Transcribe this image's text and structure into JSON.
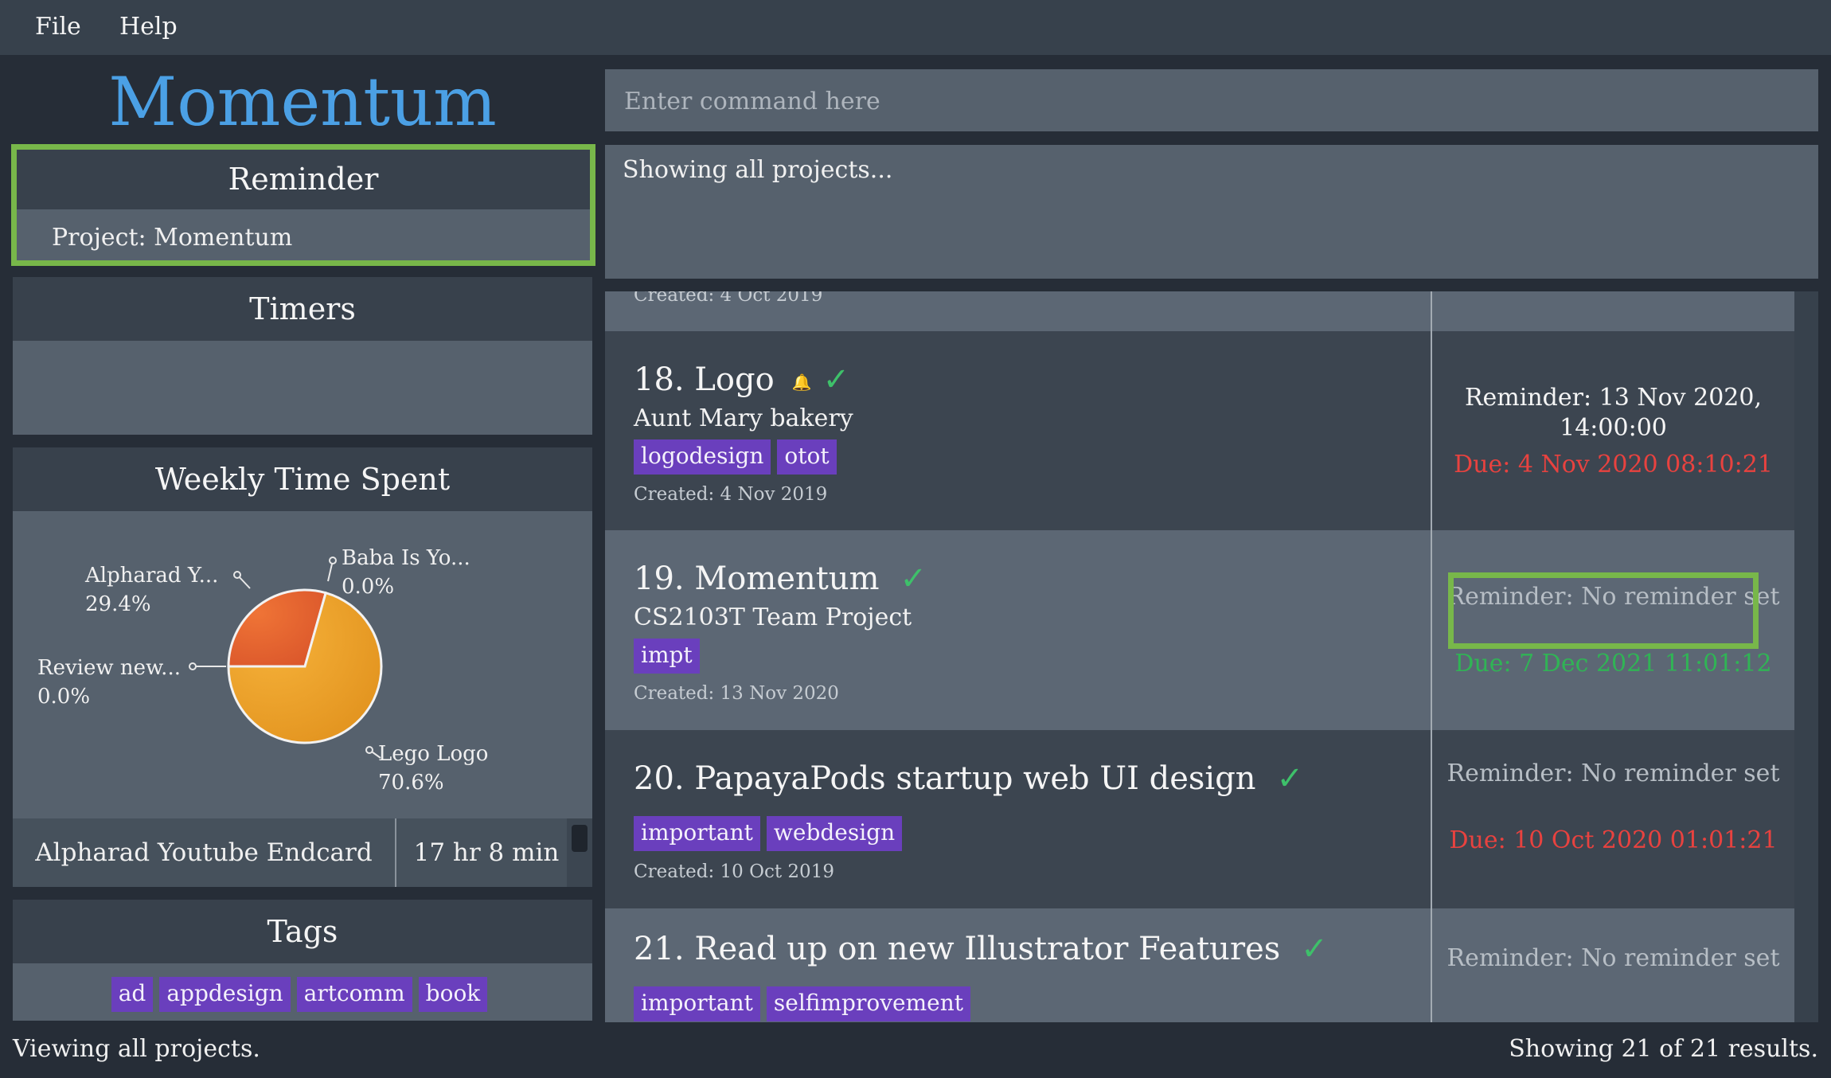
{
  "menu": {
    "file": "File",
    "help": "Help"
  },
  "app_title": "Momentum",
  "reminder": {
    "title": "Reminder",
    "text": "Project: Momentum"
  },
  "timers": {
    "title": "Timers"
  },
  "weekly": {
    "title": "Weekly Time Spent",
    "slices": [
      {
        "label": "Alpharad Y...",
        "value_text": "29.4%",
        "value": 29.4,
        "color": "#e5672f"
      },
      {
        "label": "Baba Is Yo...",
        "value_text": "0.0%",
        "value": 0.0,
        "color": "#f2c94c"
      },
      {
        "label": "Review new...",
        "value_text": "0.0%",
        "value": 0.0,
        "color": "#e8e8e8"
      },
      {
        "label": "Lego Logo",
        "value_text": "70.6%",
        "value": 70.6,
        "color": "#f0a32a"
      }
    ],
    "time_row": {
      "name": "Alpharad Youtube Endcard",
      "time": "17 hr 8 min"
    }
  },
  "tags_panel": {
    "title": "Tags",
    "tags": [
      "ad",
      "appdesign",
      "artcomm",
      "book"
    ]
  },
  "command": {
    "placeholder": "Enter command here"
  },
  "result": {
    "text": "Showing all projects..."
  },
  "projects": {
    "partial_created": "Created: 4 Oct 2019",
    "items": [
      {
        "title": "18. Logo",
        "description": "Aunt Mary bakery",
        "tags": [
          "logodesign",
          "otot"
        ],
        "created": "Created: 4 Nov 2019",
        "reminder": "Reminder: 13 Nov 2020, 14:00:00",
        "due": "Due: 4 Nov 2020 08:10:21"
      },
      {
        "title": "19. Momentum",
        "description": "CS2103T Team Project",
        "tags": [
          "impt"
        ],
        "created": "Created: 13 Nov 2020",
        "reminder": "Reminder: No reminder set",
        "due": "Due: 7 Dec 2021 11:01:12"
      },
      {
        "title": "20. PapayaPods startup web UI design",
        "tags": [
          "important",
          "webdesign"
        ],
        "created": "Created: 10 Oct 2019",
        "reminder": "Reminder: No reminder set",
        "due": "Due: 10 Oct 2020 01:01:21"
      },
      {
        "title": "21. Read up on new Illustrator Features",
        "tags": [
          "important",
          "selfimprovement"
        ],
        "reminder": "Reminder: No reminder set"
      }
    ]
  },
  "status": {
    "left": "Viewing all projects.",
    "right": "Showing 21 of 21 results."
  },
  "icons": {
    "check": "check-icon",
    "bell": "bell-icon"
  }
}
